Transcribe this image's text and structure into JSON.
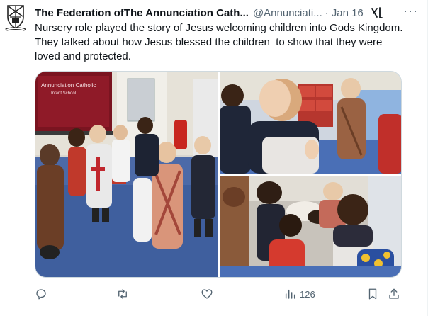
{
  "tweet": {
    "author_name": "The Federation ofThe Annunciation Cath...",
    "handle": "@Annunciati...",
    "separator": "·",
    "date": "Jan 16",
    "more_label": "···",
    "text_lines": [
      "Nursery role played the story of Jesus welcoming children into Gods Kingdom.",
      "They talked about how Jesus blessed the children  to show that they were",
      "loved and protected."
    ],
    "media": {
      "board_text": "Annunciation Catholic",
      "board_subtext": "Infant School"
    },
    "actions": {
      "reply_icon": "reply-icon",
      "retweet_icon": "retweet-icon",
      "like_icon": "heart-icon",
      "views_icon": "views-icon",
      "views_count": "126",
      "bookmark_icon": "bookmark-icon",
      "share_icon": "share-icon"
    }
  },
  "colors": {
    "text_primary": "#0f1419",
    "text_secondary": "#536471",
    "border": "#cfd9de"
  }
}
